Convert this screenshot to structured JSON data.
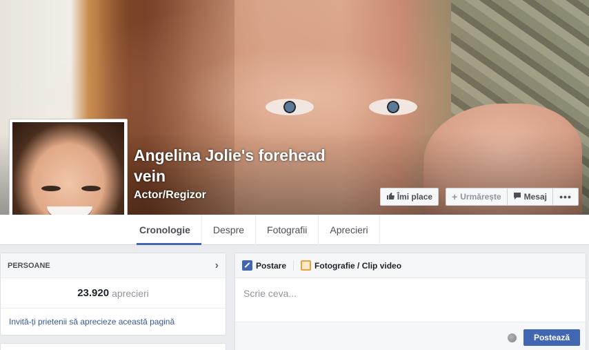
{
  "page": {
    "name": "Angelina Jolie's forehead vein",
    "category": "Actor/Regizor"
  },
  "cover_actions": {
    "like_label": "Îmi place",
    "follow_label": "Urmărește",
    "message_label": "Mesaj",
    "more_label": "•••"
  },
  "tabs": [
    {
      "label": "Cronologie",
      "active": true
    },
    {
      "label": "Despre"
    },
    {
      "label": "Fotografii"
    },
    {
      "label": "Aprecieri"
    }
  ],
  "people": {
    "header": "PERSOANE",
    "count": "23.920",
    "count_label": "aprecieri",
    "invite": "Invită-ți prietenii să aprecieze această pagină"
  },
  "composer": {
    "tab_post": "Postare",
    "tab_photo": "Fotografie / Clip video",
    "placeholder": "Scrie ceva...",
    "post_button": "Postează"
  },
  "colors": {
    "accent": "#4267b2",
    "link": "#365899",
    "background": "#e9ebee"
  }
}
